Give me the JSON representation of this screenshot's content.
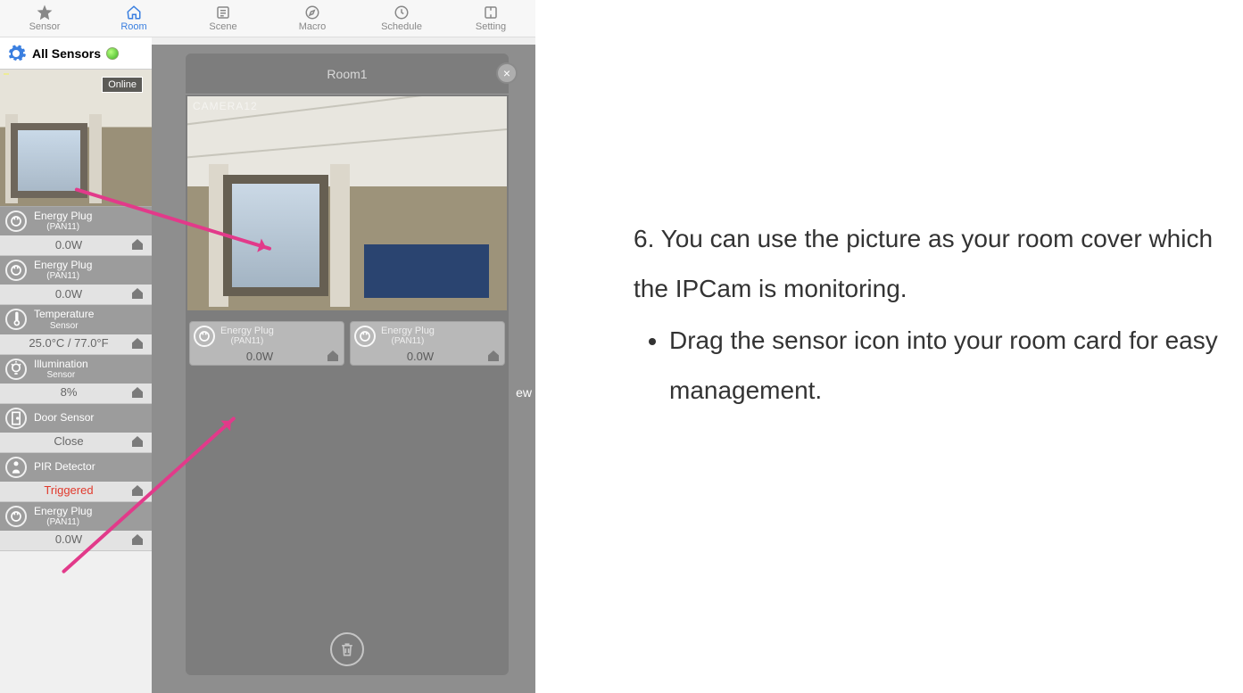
{
  "topnav": {
    "tabs": [
      {
        "label": "Sensor"
      },
      {
        "label": "Room"
      },
      {
        "label": "Scene"
      },
      {
        "label": "Macro"
      },
      {
        "label": "Schedule"
      },
      {
        "label": "Setting"
      }
    ],
    "active": 1
  },
  "left": {
    "header": "All Sensors",
    "camera_status": "Online",
    "camera_timestamp": "",
    "sensors": [
      {
        "name": "Energy Plug",
        "sub": "(PAN11)",
        "value": "0.0W",
        "icon": "plug"
      },
      {
        "name": "Energy Plug",
        "sub": "(PAN11)",
        "value": "0.0W",
        "icon": "plug"
      },
      {
        "name": "Temperature",
        "sub": "Sensor",
        "value": "25.0°C / 77.0°F",
        "icon": "temp"
      },
      {
        "name": "Illumination",
        "sub": "Sensor",
        "value": "8%",
        "icon": "bulb"
      },
      {
        "name": "Door Sensor",
        "sub": "",
        "value": "Close",
        "icon": "door"
      },
      {
        "name": "PIR Detector",
        "sub": "",
        "value": "Triggered",
        "icon": "pir",
        "red": true
      },
      {
        "name": "Energy Plug",
        "sub": "(PAN11)",
        "value": "0.0W",
        "icon": "plug"
      }
    ]
  },
  "room": {
    "title": "Room1",
    "watermark": "CAMERA12",
    "plugs": [
      {
        "name": "Energy Plug",
        "sub": "(PAN11)",
        "value": "0.0W"
      },
      {
        "name": "Energy Plug",
        "sub": "(PAN11)",
        "value": "0.0W"
      }
    ],
    "peek": "ew"
  },
  "doc": {
    "step_text": "6. You can use the picture as your room cover which the IPCam is monitoring.",
    "bullet_text": "Drag the sensor icon into your room card for easy management."
  }
}
